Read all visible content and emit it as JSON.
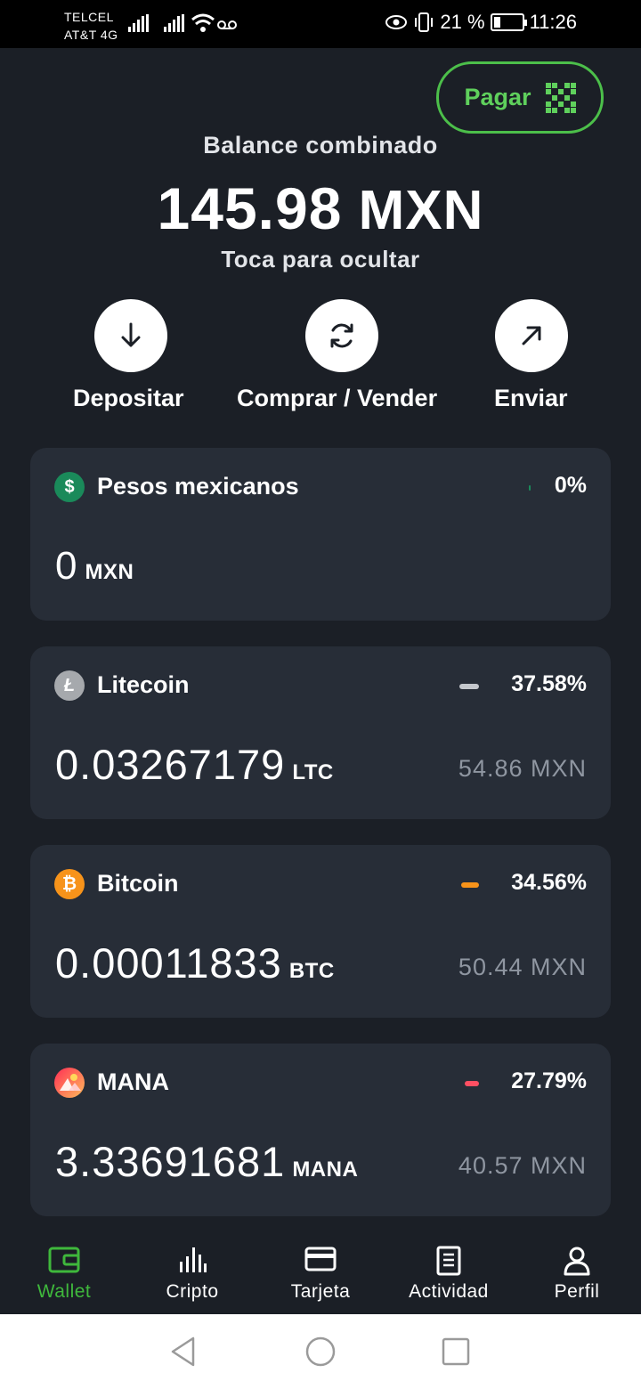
{
  "status_bar": {
    "carrier_line1": "TELCEL",
    "carrier_line2": "AT&T 4G",
    "battery_percent": "21 %",
    "time": "11:26"
  },
  "header": {
    "pay_button_label": "Pagar",
    "balance_label": "Balance combinado",
    "balance_amount": "145.98",
    "balance_currency": "MXN",
    "hide_hint": "Toca para ocultar"
  },
  "actions": [
    {
      "label": "Depositar",
      "icon": "arrow-down-icon"
    },
    {
      "label": "Comprar / Vender",
      "icon": "refresh-icon"
    },
    {
      "label": "Enviar",
      "icon": "arrow-up-right-icon"
    }
  ],
  "assets": [
    {
      "name": "Pesos mexicanos",
      "percent": "0%",
      "amount": "0",
      "unit": "MXN",
      "fiat": "",
      "icon": "dollar-icon",
      "color": "#1a8a5a",
      "bar_color": "#1a8a5a"
    },
    {
      "name": "Litecoin",
      "percent": "37.58%",
      "amount": "0.03267179",
      "unit": "LTC",
      "fiat": "54.86 MXN",
      "icon": "litecoin-icon",
      "color": "#a6a9ad",
      "bar_color": "#c4c7cc"
    },
    {
      "name": "Bitcoin",
      "percent": "34.56%",
      "amount": "0.00011833",
      "unit": "BTC",
      "fiat": "50.44 MXN",
      "icon": "bitcoin-icon",
      "color": "#f7931a",
      "bar_color": "#f7931a"
    },
    {
      "name": "MANA",
      "percent": "27.79%",
      "amount": "3.33691681",
      "unit": "MANA",
      "fiat": "40.57 MXN",
      "icon": "mana-icon",
      "color": "#ff5566",
      "bar_color": "#ff4f62"
    }
  ],
  "bottom_nav": [
    {
      "label": "Wallet",
      "icon": "wallet-icon",
      "active": true
    },
    {
      "label": "Cripto",
      "icon": "chart-bars-icon",
      "active": false
    },
    {
      "label": "Tarjeta",
      "icon": "card-icon",
      "active": false
    },
    {
      "label": "Actividad",
      "icon": "document-icon",
      "active": false
    },
    {
      "label": "Perfil",
      "icon": "person-icon",
      "active": false
    }
  ],
  "colors": {
    "background": "#1b1f26",
    "card": "#272d37",
    "accent_green": "#4cbf4a",
    "muted_text": "#8f96a1"
  }
}
